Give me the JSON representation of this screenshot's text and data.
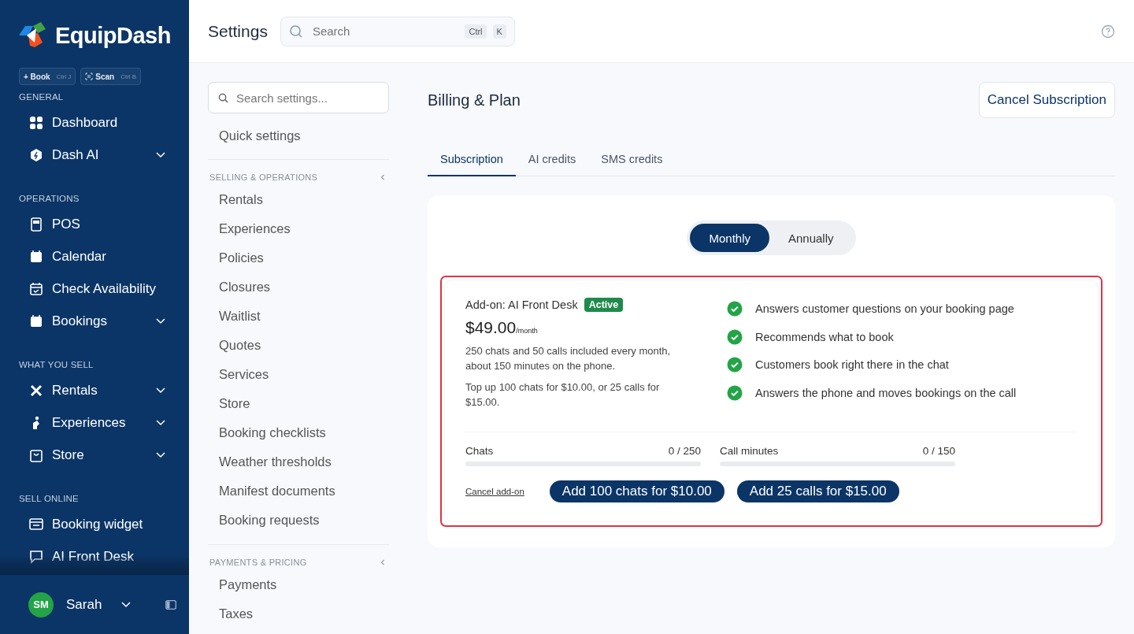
{
  "sidebar": {
    "brand": "EquipDash",
    "quick_actions": [
      {
        "label": "+ Book",
        "shortcut": "Ctrl J"
      },
      {
        "label": "Scan",
        "shortcut": "Ctrl B"
      }
    ],
    "sections": [
      {
        "title": "GENERAL",
        "items": [
          {
            "label": "Dashboard",
            "has_submenu": false
          },
          {
            "label": "Dash AI",
            "has_submenu": true
          }
        ]
      },
      {
        "title": "OPERATIONS",
        "items": [
          {
            "label": "POS",
            "has_submenu": false
          },
          {
            "label": "Calendar",
            "has_submenu": false
          },
          {
            "label": "Check Availability",
            "has_submenu": false
          },
          {
            "label": "Bookings",
            "has_submenu": true
          }
        ]
      },
      {
        "title": "WHAT YOU SELL",
        "items": [
          {
            "label": "Rentals",
            "has_submenu": true
          },
          {
            "label": "Experiences",
            "has_submenu": true
          },
          {
            "label": "Store",
            "has_submenu": true
          }
        ]
      },
      {
        "title": "SELL ONLINE",
        "items": [
          {
            "label": "Booking widget",
            "has_submenu": false
          },
          {
            "label": "AI Front Desk",
            "has_submenu": false
          }
        ]
      }
    ],
    "user": {
      "initials": "SM",
      "name": "Sarah"
    }
  },
  "header": {
    "title": "Settings",
    "search": {
      "placeholder": "Search",
      "keys": [
        "Ctrl",
        "K"
      ]
    }
  },
  "settings_nav": {
    "search": {
      "placeholder": "Search settings..."
    },
    "quick": "Quick settings",
    "groups": [
      {
        "title": "SELLING & OPERATIONS",
        "expanded": true,
        "items": [
          "Rentals",
          "Experiences",
          "Policies",
          "Closures",
          "Waitlist",
          "Quotes",
          "Services",
          "Store",
          "Booking checklists",
          "Weather thresholds",
          "Manifest documents",
          "Booking requests"
        ]
      },
      {
        "title": "PAYMENTS & PRICING",
        "expanded": true,
        "items": [
          "Payments",
          "Taxes"
        ]
      }
    ]
  },
  "page": {
    "title": "Billing & Plan",
    "cancel_button": "Cancel Subscription",
    "tabs": [
      {
        "label": "Subscription",
        "selected": true
      },
      {
        "label": "AI credits",
        "selected": false
      },
      {
        "label": "SMS credits",
        "selected": false
      }
    ],
    "billing_period": [
      {
        "label": "Monthly",
        "selected": true
      },
      {
        "label": "Annually",
        "selected": false
      }
    ],
    "addon": {
      "highlighted": true,
      "title": "Add-on: AI Front Desk",
      "status": "Active",
      "price": "$49.00",
      "period": "/month",
      "description": "250 chats and 50 calls included every month, about 150 minutes on the phone.",
      "topup": "Top up 100 chats for $10.00, or 25 calls for $15.00.",
      "features": [
        "Answers customer questions on your booking page",
        "Recommends what to book",
        "Customers book right there in the chat",
        "Answers the phone and moves bookings on the call"
      ],
      "meters": [
        {
          "label": "Chats",
          "reading": "0 / 250",
          "level": 0
        },
        {
          "label": "Call minutes",
          "reading": "0 / 150",
          "level": 0
        }
      ],
      "cancel_link": "Cancel add-on",
      "buttons": [
        "Add 100 chats for $10.00",
        "Add 25 calls for $15.00"
      ]
    }
  }
}
